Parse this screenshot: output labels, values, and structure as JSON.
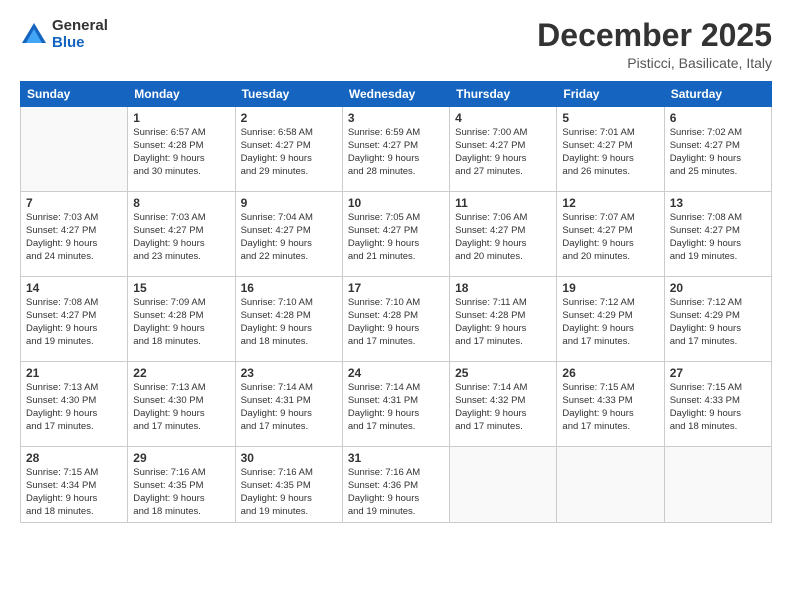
{
  "logo": {
    "general": "General",
    "blue": "Blue"
  },
  "header": {
    "month": "December 2025",
    "location": "Pisticci, Basilicate, Italy"
  },
  "weekdays": [
    "Sunday",
    "Monday",
    "Tuesday",
    "Wednesday",
    "Thursday",
    "Friday",
    "Saturday"
  ],
  "weeks": [
    [
      {
        "day": "",
        "info": ""
      },
      {
        "day": "1",
        "info": "Sunrise: 6:57 AM\nSunset: 4:28 PM\nDaylight: 9 hours\nand 30 minutes."
      },
      {
        "day": "2",
        "info": "Sunrise: 6:58 AM\nSunset: 4:27 PM\nDaylight: 9 hours\nand 29 minutes."
      },
      {
        "day": "3",
        "info": "Sunrise: 6:59 AM\nSunset: 4:27 PM\nDaylight: 9 hours\nand 28 minutes."
      },
      {
        "day": "4",
        "info": "Sunrise: 7:00 AM\nSunset: 4:27 PM\nDaylight: 9 hours\nand 27 minutes."
      },
      {
        "day": "5",
        "info": "Sunrise: 7:01 AM\nSunset: 4:27 PM\nDaylight: 9 hours\nand 26 minutes."
      },
      {
        "day": "6",
        "info": "Sunrise: 7:02 AM\nSunset: 4:27 PM\nDaylight: 9 hours\nand 25 minutes."
      }
    ],
    [
      {
        "day": "7",
        "info": "Sunrise: 7:03 AM\nSunset: 4:27 PM\nDaylight: 9 hours\nand 24 minutes."
      },
      {
        "day": "8",
        "info": "Sunrise: 7:03 AM\nSunset: 4:27 PM\nDaylight: 9 hours\nand 23 minutes."
      },
      {
        "day": "9",
        "info": "Sunrise: 7:04 AM\nSunset: 4:27 PM\nDaylight: 9 hours\nand 22 minutes."
      },
      {
        "day": "10",
        "info": "Sunrise: 7:05 AM\nSunset: 4:27 PM\nDaylight: 9 hours\nand 21 minutes."
      },
      {
        "day": "11",
        "info": "Sunrise: 7:06 AM\nSunset: 4:27 PM\nDaylight: 9 hours\nand 20 minutes."
      },
      {
        "day": "12",
        "info": "Sunrise: 7:07 AM\nSunset: 4:27 PM\nDaylight: 9 hours\nand 20 minutes."
      },
      {
        "day": "13",
        "info": "Sunrise: 7:08 AM\nSunset: 4:27 PM\nDaylight: 9 hours\nand 19 minutes."
      }
    ],
    [
      {
        "day": "14",
        "info": "Sunrise: 7:08 AM\nSunset: 4:27 PM\nDaylight: 9 hours\nand 19 minutes."
      },
      {
        "day": "15",
        "info": "Sunrise: 7:09 AM\nSunset: 4:28 PM\nDaylight: 9 hours\nand 18 minutes."
      },
      {
        "day": "16",
        "info": "Sunrise: 7:10 AM\nSunset: 4:28 PM\nDaylight: 9 hours\nand 18 minutes."
      },
      {
        "day": "17",
        "info": "Sunrise: 7:10 AM\nSunset: 4:28 PM\nDaylight: 9 hours\nand 17 minutes."
      },
      {
        "day": "18",
        "info": "Sunrise: 7:11 AM\nSunset: 4:28 PM\nDaylight: 9 hours\nand 17 minutes."
      },
      {
        "day": "19",
        "info": "Sunrise: 7:12 AM\nSunset: 4:29 PM\nDaylight: 9 hours\nand 17 minutes."
      },
      {
        "day": "20",
        "info": "Sunrise: 7:12 AM\nSunset: 4:29 PM\nDaylight: 9 hours\nand 17 minutes."
      }
    ],
    [
      {
        "day": "21",
        "info": "Sunrise: 7:13 AM\nSunset: 4:30 PM\nDaylight: 9 hours\nand 17 minutes."
      },
      {
        "day": "22",
        "info": "Sunrise: 7:13 AM\nSunset: 4:30 PM\nDaylight: 9 hours\nand 17 minutes."
      },
      {
        "day": "23",
        "info": "Sunrise: 7:14 AM\nSunset: 4:31 PM\nDaylight: 9 hours\nand 17 minutes."
      },
      {
        "day": "24",
        "info": "Sunrise: 7:14 AM\nSunset: 4:31 PM\nDaylight: 9 hours\nand 17 minutes."
      },
      {
        "day": "25",
        "info": "Sunrise: 7:14 AM\nSunset: 4:32 PM\nDaylight: 9 hours\nand 17 minutes."
      },
      {
        "day": "26",
        "info": "Sunrise: 7:15 AM\nSunset: 4:33 PM\nDaylight: 9 hours\nand 17 minutes."
      },
      {
        "day": "27",
        "info": "Sunrise: 7:15 AM\nSunset: 4:33 PM\nDaylight: 9 hours\nand 18 minutes."
      }
    ],
    [
      {
        "day": "28",
        "info": "Sunrise: 7:15 AM\nSunset: 4:34 PM\nDaylight: 9 hours\nand 18 minutes."
      },
      {
        "day": "29",
        "info": "Sunrise: 7:16 AM\nSunset: 4:35 PM\nDaylight: 9 hours\nand 18 minutes."
      },
      {
        "day": "30",
        "info": "Sunrise: 7:16 AM\nSunset: 4:35 PM\nDaylight: 9 hours\nand 19 minutes."
      },
      {
        "day": "31",
        "info": "Sunrise: 7:16 AM\nSunset: 4:36 PM\nDaylight: 9 hours\nand 19 minutes."
      },
      {
        "day": "",
        "info": ""
      },
      {
        "day": "",
        "info": ""
      },
      {
        "day": "",
        "info": ""
      }
    ]
  ]
}
